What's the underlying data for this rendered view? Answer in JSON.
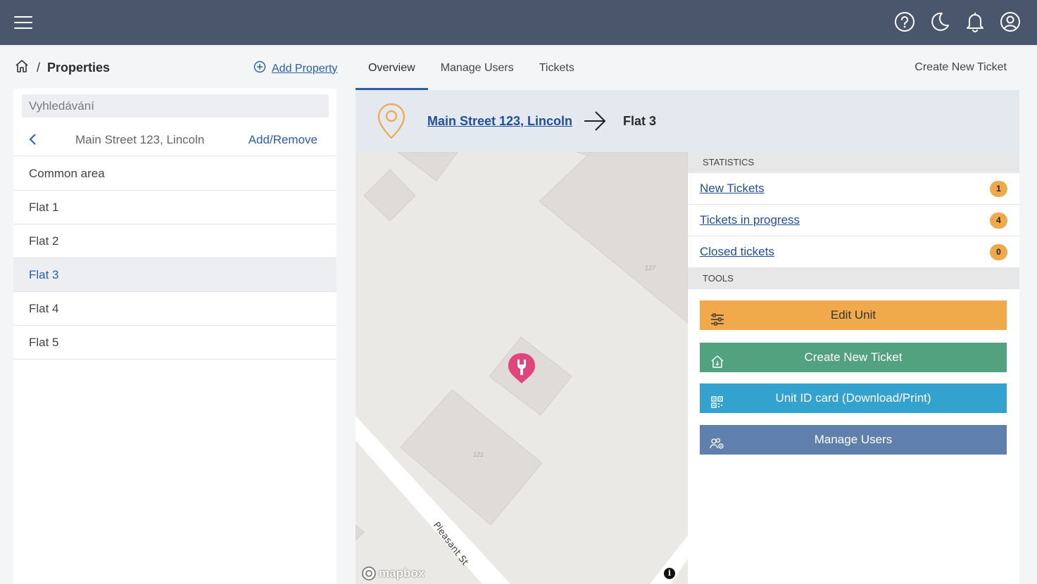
{
  "topbar": {
    "icons": [
      "menu-icon",
      "help-icon",
      "moon-icon",
      "bell-icon",
      "user-icon"
    ]
  },
  "breadcrumb": {
    "separator": "/",
    "title": "Properties"
  },
  "add_property": "Add Property",
  "search": {
    "placeholder": "Vyhledávání"
  },
  "property_nav": {
    "address": "Main Street 123, Lincoln",
    "add_remove": "Add/Remove"
  },
  "units": [
    {
      "label": "Common area",
      "active": false
    },
    {
      "label": "Flat 1",
      "active": false
    },
    {
      "label": "Flat 2",
      "active": false
    },
    {
      "label": "Flat 3",
      "active": true
    },
    {
      "label": "Flat 4",
      "active": false
    },
    {
      "label": "Flat 5",
      "active": false
    }
  ],
  "tabs": [
    {
      "label": "Overview",
      "active": true
    },
    {
      "label": "Manage Users",
      "active": false
    },
    {
      "label": "Tickets",
      "active": false
    }
  ],
  "create_new_ticket_top": "Create New Ticket",
  "card_header": {
    "property_link": "Main Street 123, Lincoln",
    "unit": "Flat 3"
  },
  "map": {
    "street": "Pleasant St",
    "house_numbers": [
      "127",
      "121"
    ],
    "attribution": "mapbox",
    "info": "i"
  },
  "statistics": {
    "heading": "STATISTICS",
    "items": [
      {
        "label": "New Tickets",
        "count": "1"
      },
      {
        "label": "Tickets in progress",
        "count": "4"
      },
      {
        "label": "Closed tickets",
        "count": "0"
      }
    ]
  },
  "tools": {
    "heading": "TOOLS",
    "edit_unit": "Edit Unit",
    "create_ticket": "Create New Ticket",
    "unit_id_card": "Unit ID card (Download/Print)",
    "manage_users": "Manage Users"
  },
  "colors": {
    "topbar": "#4a566b",
    "link": "#1f4f9e",
    "edit": "#f0aa4b",
    "create": "#52a27f",
    "idcard": "#34a2cf",
    "users": "#5f80ad",
    "badge": "#f0a94a",
    "pin": "#f0a94a",
    "marker": "#e0457b"
  }
}
